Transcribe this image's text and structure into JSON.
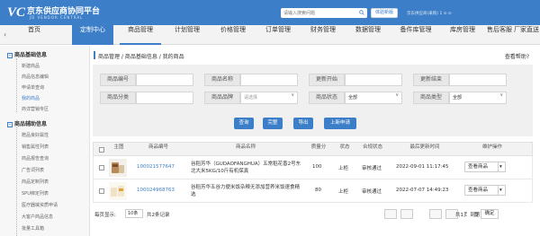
{
  "header": {
    "logo_mark": "VC",
    "title": "京东供应商协同平台",
    "subtitle": "JD VENDOR CENTRAL",
    "search_placeholder": "请输入搜索问题",
    "experience_button": "体验新版",
    "user_info": "京东供应商(采购)  1  ⊙ ⊙",
    "colors": {
      "header_bg": "#3c7ec7",
      "accent": "#3c7ec7"
    }
  },
  "nav": {
    "items": [
      "首页",
      "定制中心",
      "商品管理",
      "计划管理",
      "价格管理",
      "订单管理",
      "财务管理",
      "数据管理",
      "备件库管理",
      "库房管理",
      "售后客服",
      "厂家直送"
    ],
    "active_index": 1,
    "underline_index": 2
  },
  "sidebar": {
    "sections": [
      {
        "title": "商品基础信息",
        "items": [
          "新建商品",
          "商品信息编辑",
          "申请单查询",
          "我的商品",
          "商详营销专区"
        ]
      },
      {
        "title": "商品辅助信息",
        "items": [
          "赠品良好属性",
          "销售属性列表",
          "商品报告查询",
          "广告词列表",
          "商品定制列表",
          "SPU绑定列表",
          "医疗器械资质申请",
          "大客户商品信息",
          "批量工具箱"
        ]
      }
    ],
    "active_item": "我的商品"
  },
  "breadcrumb": "商品管理 / 商品基础信息 / 我的商品",
  "help_link": "查看帮助?",
  "filters": {
    "row1": [
      {
        "label": "商品编号",
        "value": ""
      },
      {
        "label": "商品名称",
        "value": ""
      },
      {
        "label": "更新开始",
        "value": ""
      },
      {
        "label": "更新结束",
        "value": ""
      }
    ],
    "row2": [
      {
        "label": "商品分类",
        "value": ""
      },
      {
        "label": "商品品牌",
        "value": "请选择"
      },
      {
        "label": "商品状态",
        "value": "全部"
      },
      {
        "label": "商品类型",
        "value": "全部"
      }
    ]
  },
  "buttons": [
    "查询",
    "完整",
    "导出",
    "上新申请"
  ],
  "table": {
    "headers": [
      "主图",
      "商品编号",
      "商品名称",
      "质量分",
      "状态",
      "合规状态",
      "最后更新时间",
      "维护操作"
    ],
    "rows": [
      {
        "id": "100021577647",
        "name": "谷稻芳华（GUDAOFANGHUA）五常稻花香2号东北大米5KG/10斤有机保真",
        "score": "100",
        "status": "上柜",
        "compliance": "审核通过",
        "updated": "2022-09-01 11:17:45",
        "op": "查看商品"
      },
      {
        "id": "100024968763",
        "name": "谷稻芳华五谷力便米饭杂粮无添加营养米饭速食精选",
        "score": "80",
        "status": "上柜",
        "compliance": "审核通过",
        "updated": "2022-07-07 14:49:23",
        "op": "查看商品"
      }
    ]
  },
  "pager": {
    "per_page_label": "每页显示:",
    "per_page_value": "10条",
    "total_text": "共2条记录",
    "pages_text": "共1页 到第",
    "page_label": "页",
    "confirm": "确定"
  }
}
